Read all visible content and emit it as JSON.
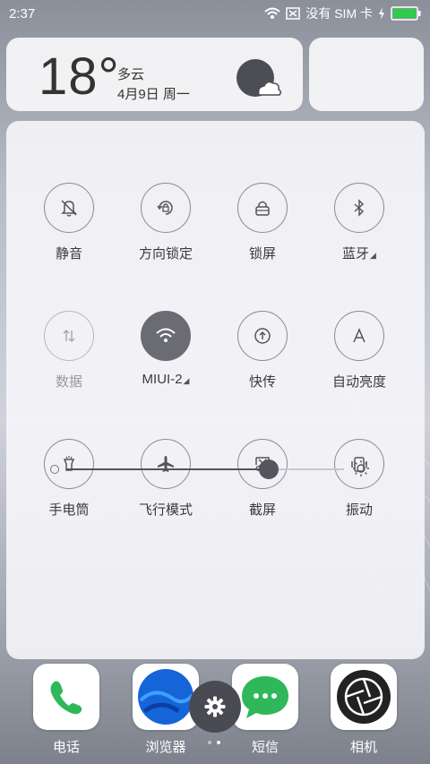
{
  "status_bar": {
    "time": "2:37",
    "carrier": "没有 SIM 卡"
  },
  "weather": {
    "temperature": "18°",
    "condition": "多云",
    "date": "4月9日 周一",
    "icon": "cloudy-icon"
  },
  "toggles": [
    {
      "label": "静音",
      "icon": "bell-off-icon",
      "active": false,
      "dim": false
    },
    {
      "label": "方向锁定",
      "icon": "rotation-lock-icon",
      "active": false,
      "dim": false
    },
    {
      "label": "锁屏",
      "icon": "lock-icon",
      "active": false,
      "dim": false
    },
    {
      "label": "蓝牙",
      "icon": "bluetooth-icon",
      "active": false,
      "dim": false
    },
    {
      "label": "数据",
      "icon": "data-icon",
      "active": false,
      "dim": true
    },
    {
      "label": "MIUI-2",
      "icon": "wifi-icon",
      "active": true,
      "dim": false
    },
    {
      "label": "快传",
      "icon": "upload-icon",
      "active": false,
      "dim": false
    },
    {
      "label": "自动亮度",
      "icon": "auto-brightness-icon",
      "active": false,
      "dim": false
    },
    {
      "label": "手电筒",
      "icon": "flashlight-icon",
      "active": false,
      "dim": false
    },
    {
      "label": "飞行模式",
      "icon": "airplane-icon",
      "active": false,
      "dim": false
    },
    {
      "label": "截屏",
      "icon": "screenshot-icon",
      "active": false,
      "dim": false
    },
    {
      "label": "振动",
      "icon": "vibrate-icon",
      "active": false,
      "dim": false
    }
  ],
  "brightness": {
    "level": 0.73
  },
  "dock": [
    {
      "label": "电话",
      "icon": "phone-icon"
    },
    {
      "label": "浏览器",
      "icon": "browser-icon"
    },
    {
      "label": "短信",
      "icon": "messages-icon"
    },
    {
      "label": "相机",
      "icon": "camera-icon"
    }
  ],
  "colors": {
    "active_toggle": "#6b6b73",
    "phone_green": "#2fb85a",
    "messages_green": "#2fb85a",
    "browser_blue": "#1565d8"
  }
}
